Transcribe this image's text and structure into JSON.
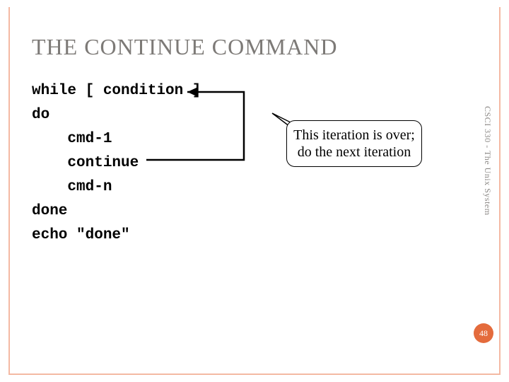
{
  "title": "THE CONTINUE COMMAND",
  "code": {
    "l1": "while [ condition ]",
    "l2": "do",
    "l3": "    cmd-1",
    "l4": "    continue",
    "l5": "    cmd-n",
    "l6": "done",
    "l7": "echo \"done\""
  },
  "callout": "This iteration is over; do the next iteration",
  "sidetext": "CSCI 330 - The Unix System",
  "page_number": "48"
}
